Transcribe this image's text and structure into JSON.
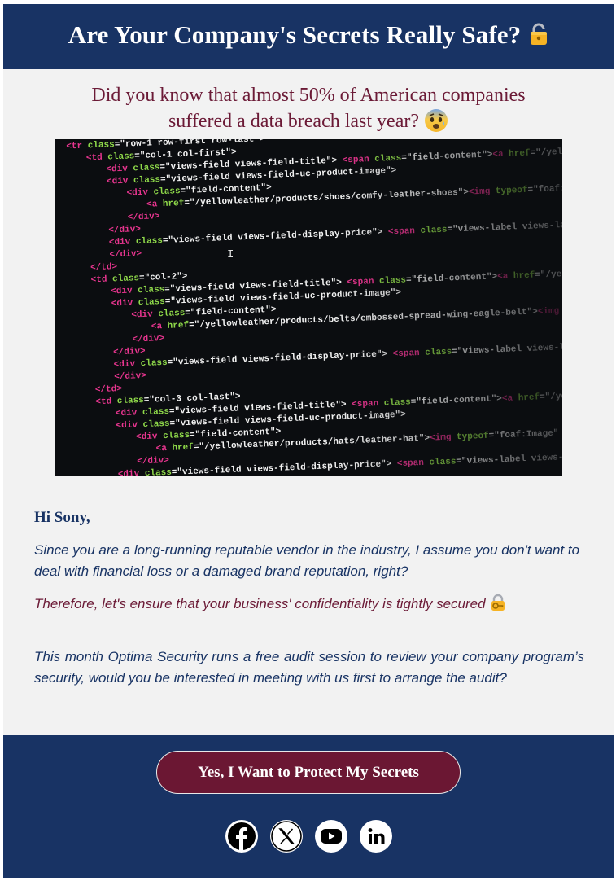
{
  "header": {
    "title": "Are Your Company's Secrets Really Safe?",
    "icon": "lock-icon"
  },
  "intro": {
    "line1": "Did you know that almost 50% of American companies",
    "line2": "suffered a data breach last year?",
    "icon": "anxious-face-icon"
  },
  "hero_image": {
    "icon": "code-screenshot"
  },
  "body": {
    "greeting": "Hi Sony,",
    "paragraph1": "Since you are a long-running reputable vendor in the industry, I assume you don't want to deal with financial loss or a damaged brand reputation, right?",
    "paragraph2": "Therefore, let's ensure that your business' confidentiality is tightly secured",
    "paragraph2_icon": "locked-with-key-icon",
    "paragraph3": "This month Optima Security runs a free audit session to review your company program’s security, would you be interested in meeting with us first to arrange the audit?"
  },
  "footer": {
    "cta_label": "Yes, I Want to Protect My Secrets",
    "socials": [
      "facebook-icon",
      "x-icon",
      "youtube-icon",
      "linkedin-icon"
    ]
  },
  "colors": {
    "navy": "#183364",
    "maroon": "#6b1a36",
    "background": "#f2f2f2"
  }
}
